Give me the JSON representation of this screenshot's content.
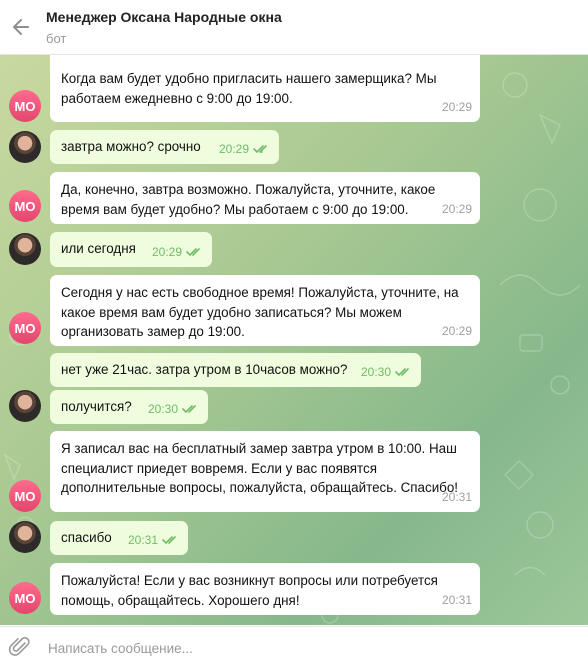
{
  "header": {
    "title": "Менеджер Оксана Народные окна",
    "subtitle": "бот"
  },
  "avatars": {
    "bot_initials": "МО"
  },
  "messages": [
    {
      "side": "in",
      "text": "Когда вам будет удобно пригласить нашего замерщика? Мы работаем ежедневно с 9:00 до 19:00.",
      "time": "20:29"
    },
    {
      "side": "out",
      "text": "завтра можно? срочно",
      "time": "20:29"
    },
    {
      "side": "in",
      "text": "Да, конечно, завтра возможно. Пожалуйста, уточните, какое время вам будет удобно? Мы работаем с 9:00 до 19:00.",
      "time": "20:29"
    },
    {
      "side": "out",
      "text": "или сегодня",
      "time": "20:29"
    },
    {
      "side": "in",
      "text": "Сегодня у нас есть свободное время! Пожалуйста, уточните, на какое время вам будет удобно записаться? Мы можем организовать замер до 19:00.",
      "time": "20:29"
    },
    {
      "side": "out",
      "text": "нет уже 21час. затра утром в 10часов можно?",
      "time": "20:30"
    },
    {
      "side": "out",
      "text": "получится?",
      "time": "20:30"
    },
    {
      "side": "in",
      "text": "Я записал вас на бесплатный замер завтра утром в 10:00. Наш специалист приедет вовремя. Если у вас появятся дополнительные вопросы, пожалуйста, обращайтесь. Спасибо!",
      "time": "20:31"
    },
    {
      "side": "out",
      "text": "спасибо",
      "time": "20:31"
    },
    {
      "side": "in",
      "text": "Пожалуйста! Если у вас возникнут вопросы или потребуется помощь, обращайтесь. Хорошего дня!",
      "time": "20:31"
    }
  ],
  "composer": {
    "placeholder": "Написать сообщение..."
  },
  "colors": {
    "incoming_bubble": "#ffffff",
    "outgoing_bubble": "#effdde",
    "read_check": "#6fbc66",
    "bot_avatar": "#e94f75"
  },
  "icons": {
    "back": "arrow-left-icon",
    "attach": "paperclip-icon",
    "read": "double-check-icon"
  }
}
